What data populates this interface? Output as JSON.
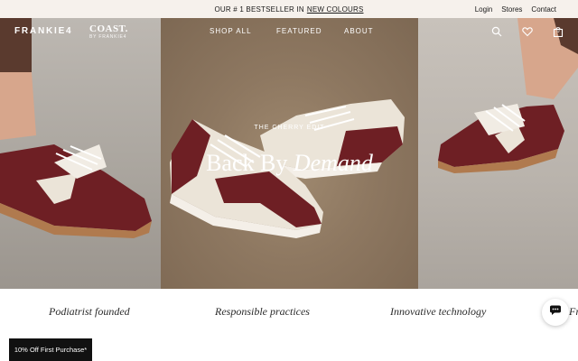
{
  "announcement": {
    "text": "OUR # 1 BESTSELLER IN",
    "link": "NEW COLOURS"
  },
  "utility_links": [
    "Login",
    "Stores",
    "Contact"
  ],
  "brand": {
    "logo": "FRANKIE4",
    "sub_brand": "COAST.",
    "sub_brand_tagline": "BY FRANKIE4"
  },
  "nav": {
    "items": [
      "SHOP ALL",
      "FEATURED",
      "ABOUT"
    ]
  },
  "header_icons": [
    "search-icon",
    "heart-icon",
    "bag-icon"
  ],
  "cart": {
    "count": "0"
  },
  "hero": {
    "eyebrow": "THE CHERRY EDIT",
    "headline_plain": "Back By",
    "headline_italic": "Demand"
  },
  "usp": {
    "items": [
      "Podiatrist founded",
      "Responsible practices",
      "Innovative technology",
      "Fr"
    ]
  },
  "promo": {
    "label": "10% Off First Purchase*"
  },
  "chat": {
    "icon": "chat-icon"
  },
  "colors": {
    "announcement_bg": "#f6f1ec",
    "promo_bg": "#111111",
    "shoe_burgundy": "#6e1f24",
    "shoe_cream": "#ebe4d8"
  }
}
